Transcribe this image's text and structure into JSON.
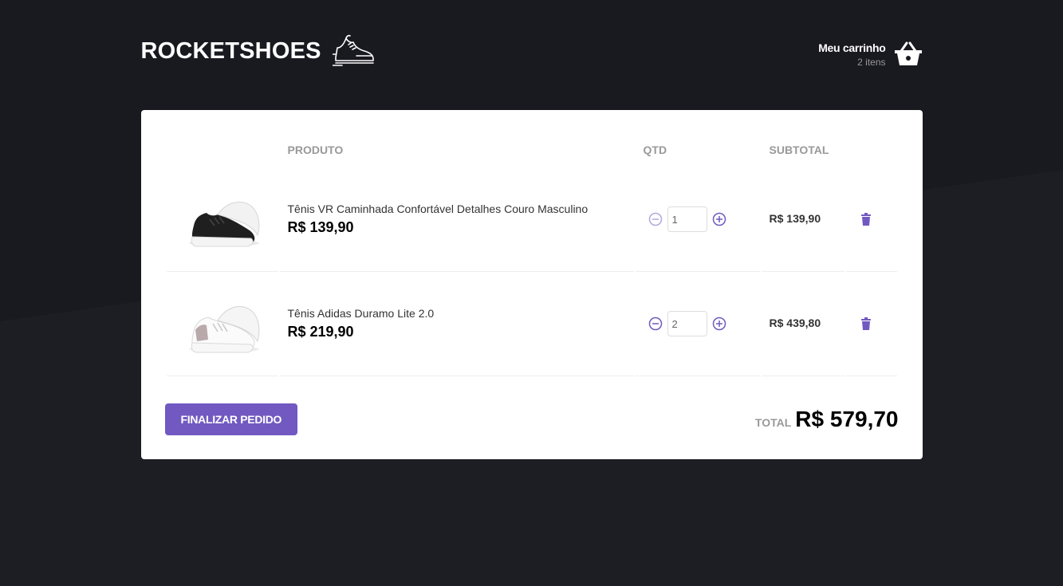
{
  "header": {
    "logo_text": "ROCKETSHOES",
    "cart_title": "Meu carrinho",
    "cart_count": "2 itens"
  },
  "colors": {
    "background": "#191920",
    "accent": "#7159c1",
    "card": "#ffffff"
  },
  "table": {
    "headers": {
      "image": "",
      "product": "PRODUTO",
      "qty": "QTD",
      "subtotal": "SUBTOTAL"
    },
    "rows": [
      {
        "name": "Tênis VR Caminhada Confortável Detalhes Couro Masculino",
        "price": "R$ 139,90",
        "qty": "1",
        "subtotal": "R$ 139,90",
        "shoe_color": "black"
      },
      {
        "name": "Tênis Adidas Duramo Lite 2.0",
        "price": "R$ 219,90",
        "qty": "2",
        "subtotal": "R$ 439,80",
        "shoe_color": "white"
      }
    ]
  },
  "footer": {
    "checkout_label": "Finalizar pedido",
    "total_label": "TOTAL",
    "total_value": "R$ 579,70"
  },
  "icons": {
    "logo": "sneaker-icon",
    "cart": "basket-icon",
    "decrement": "minus-circle-icon",
    "increment": "plus-circle-icon",
    "delete": "trash-icon"
  }
}
